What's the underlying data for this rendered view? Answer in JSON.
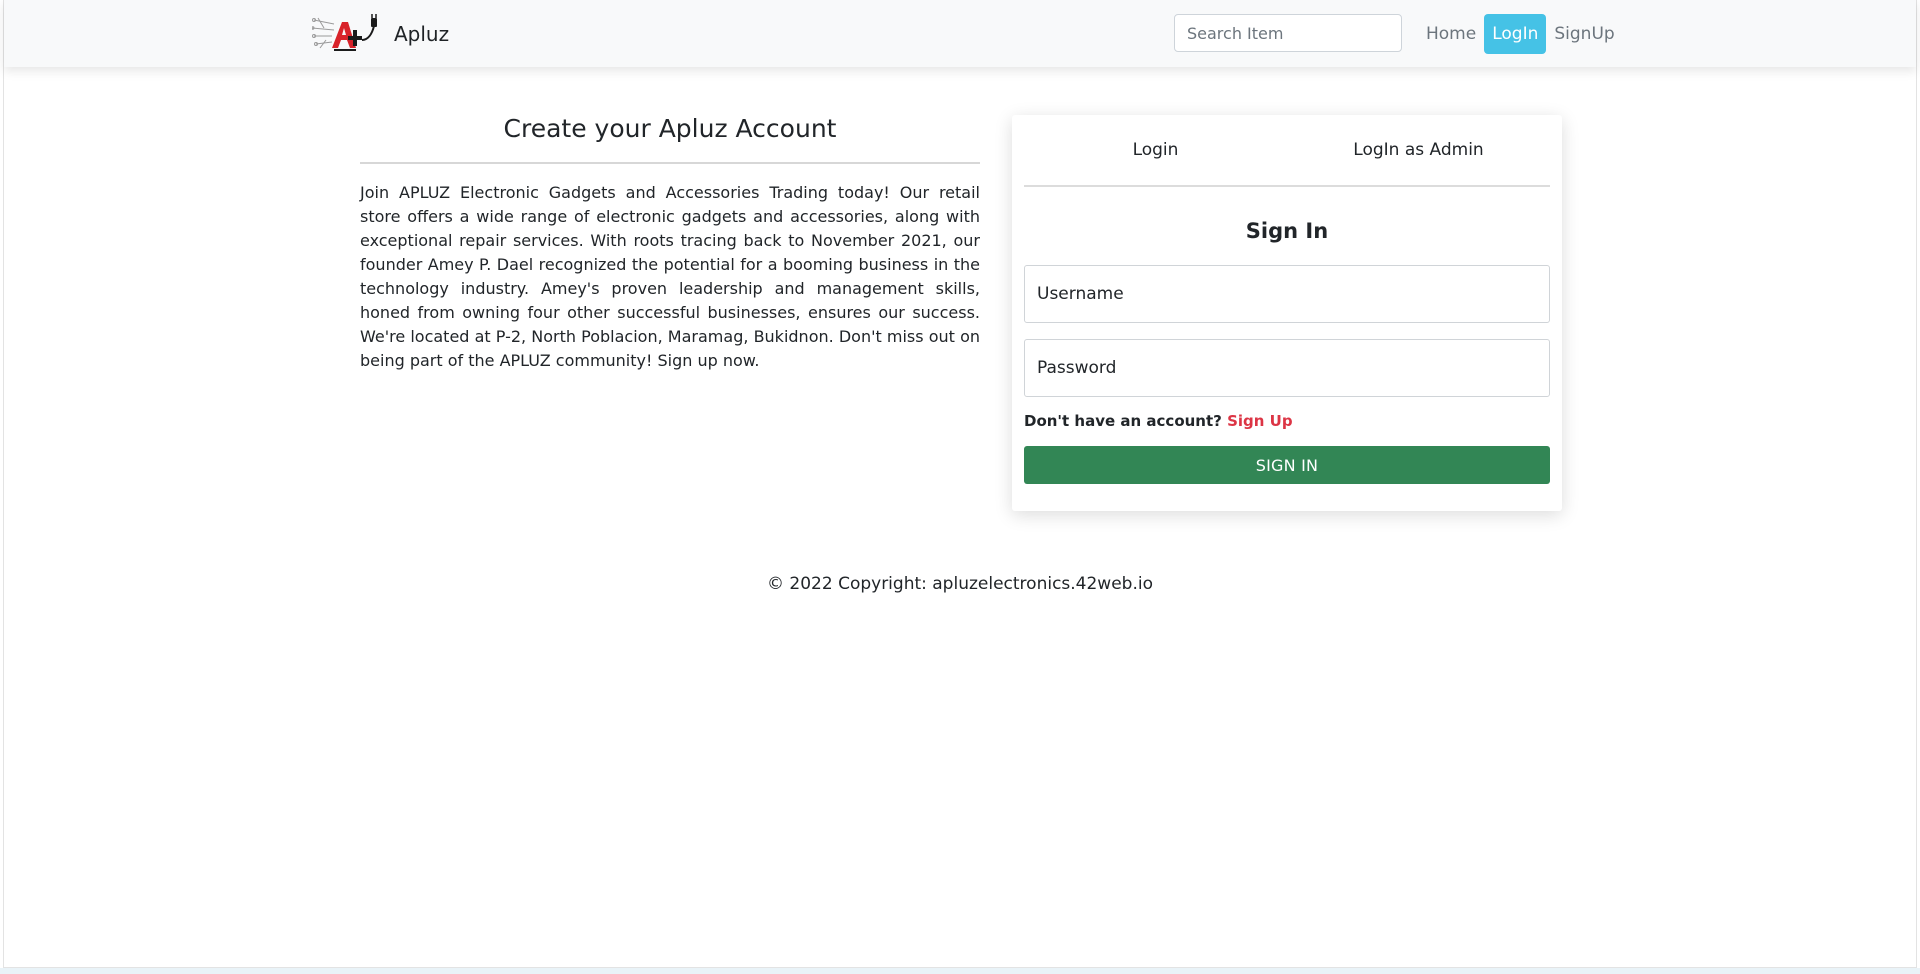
{
  "nav": {
    "brand": "Apluz",
    "search_placeholder": "Search Item",
    "links": [
      "Home",
      "LogIn",
      "SignUp"
    ],
    "active_link": "LogIn"
  },
  "intro": {
    "title": "Create your Apluz Account",
    "body": "Join APLUZ Electronic Gadgets and Accessories Trading today! Our retail store offers a wide range of electronic gadgets and accessories, along with exceptional repair services. With roots tracing back to November 2021, our founder Amey P. Dael recognized the potential for a booming business in the technology industry. Amey's proven leadership and management skills, honed from owning four other successful businesses, ensures our success. We're located at P-2, North Poblacion, Maramag, Bukidnon. Don't miss out on being part of the APLUZ community! Sign up now."
  },
  "login_card": {
    "tabs": [
      "Login",
      "LogIn as Admin"
    ],
    "title": "Sign In",
    "username_placeholder": "Username",
    "password_placeholder": "Password",
    "no_account_text": "Don't have an account?",
    "signup_link": "Sign Up",
    "submit_label": "SIGN IN"
  },
  "footer": {
    "text": "© 2022 Copyright: apluzelectronics.42web.io"
  },
  "colors": {
    "active_nav_bg": "#45c2e6",
    "signin_button": "#328655",
    "signup_link": "#dc3545"
  }
}
